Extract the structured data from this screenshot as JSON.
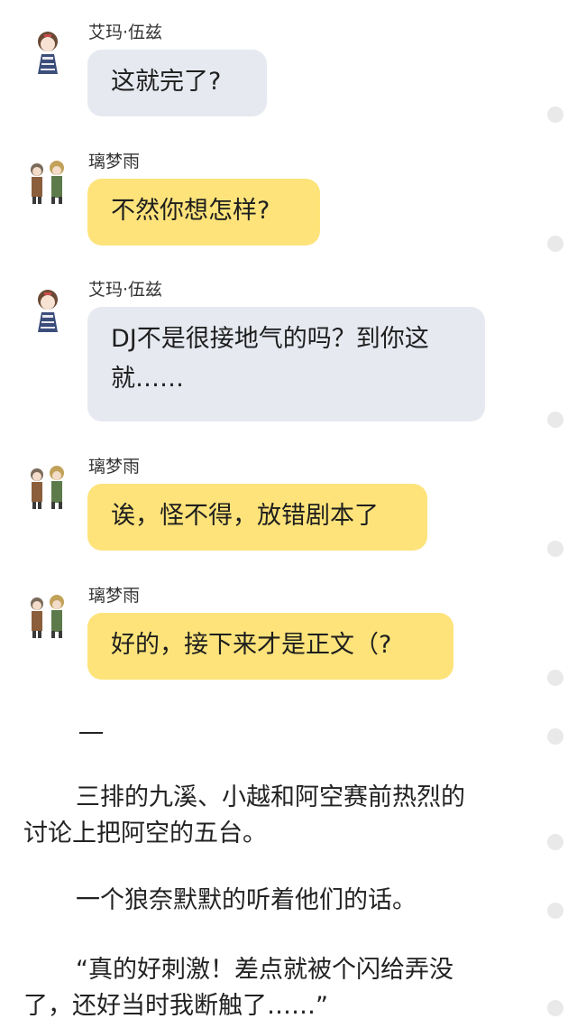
{
  "messages": [
    {
      "sender": "艾玛·伍兹",
      "text": "这就完了?",
      "style": "gray",
      "avatar": "girl-avatar"
    },
    {
      "sender": "璃梦雨",
      "text": "不然你想怎样?",
      "style": "yellow",
      "avatar": "group-avatar"
    },
    {
      "sender": "艾玛·伍兹",
      "text": "DJ不是很接地气的吗？到你这\n就……",
      "style": "gray",
      "avatar": "girl-avatar"
    },
    {
      "sender": "璃梦雨",
      "text": "诶，怪不得，放错剧本了",
      "style": "yellow",
      "avatar": "group-avatar"
    },
    {
      "sender": "璃梦雨",
      "text": "好的，接下来才是正文（?",
      "style": "yellow",
      "avatar": "group-avatar"
    }
  ],
  "story": {
    "para1_line1": "三排的九溪、小越和阿空赛前热烈的",
    "para1_line2": "讨论上把阿空的五台。",
    "para2_line1": "一个狼奈默默的听着他们的话。",
    "para3_line1": "“真的好刺激！差点就被个闪给弄没",
    "para3_line2": "了，还好当时我断触了……”"
  },
  "colors": {
    "gray_bubble": "#e6e9f0",
    "yellow_bubble": "#fde37a",
    "side_dot": "#e9e9e9"
  }
}
